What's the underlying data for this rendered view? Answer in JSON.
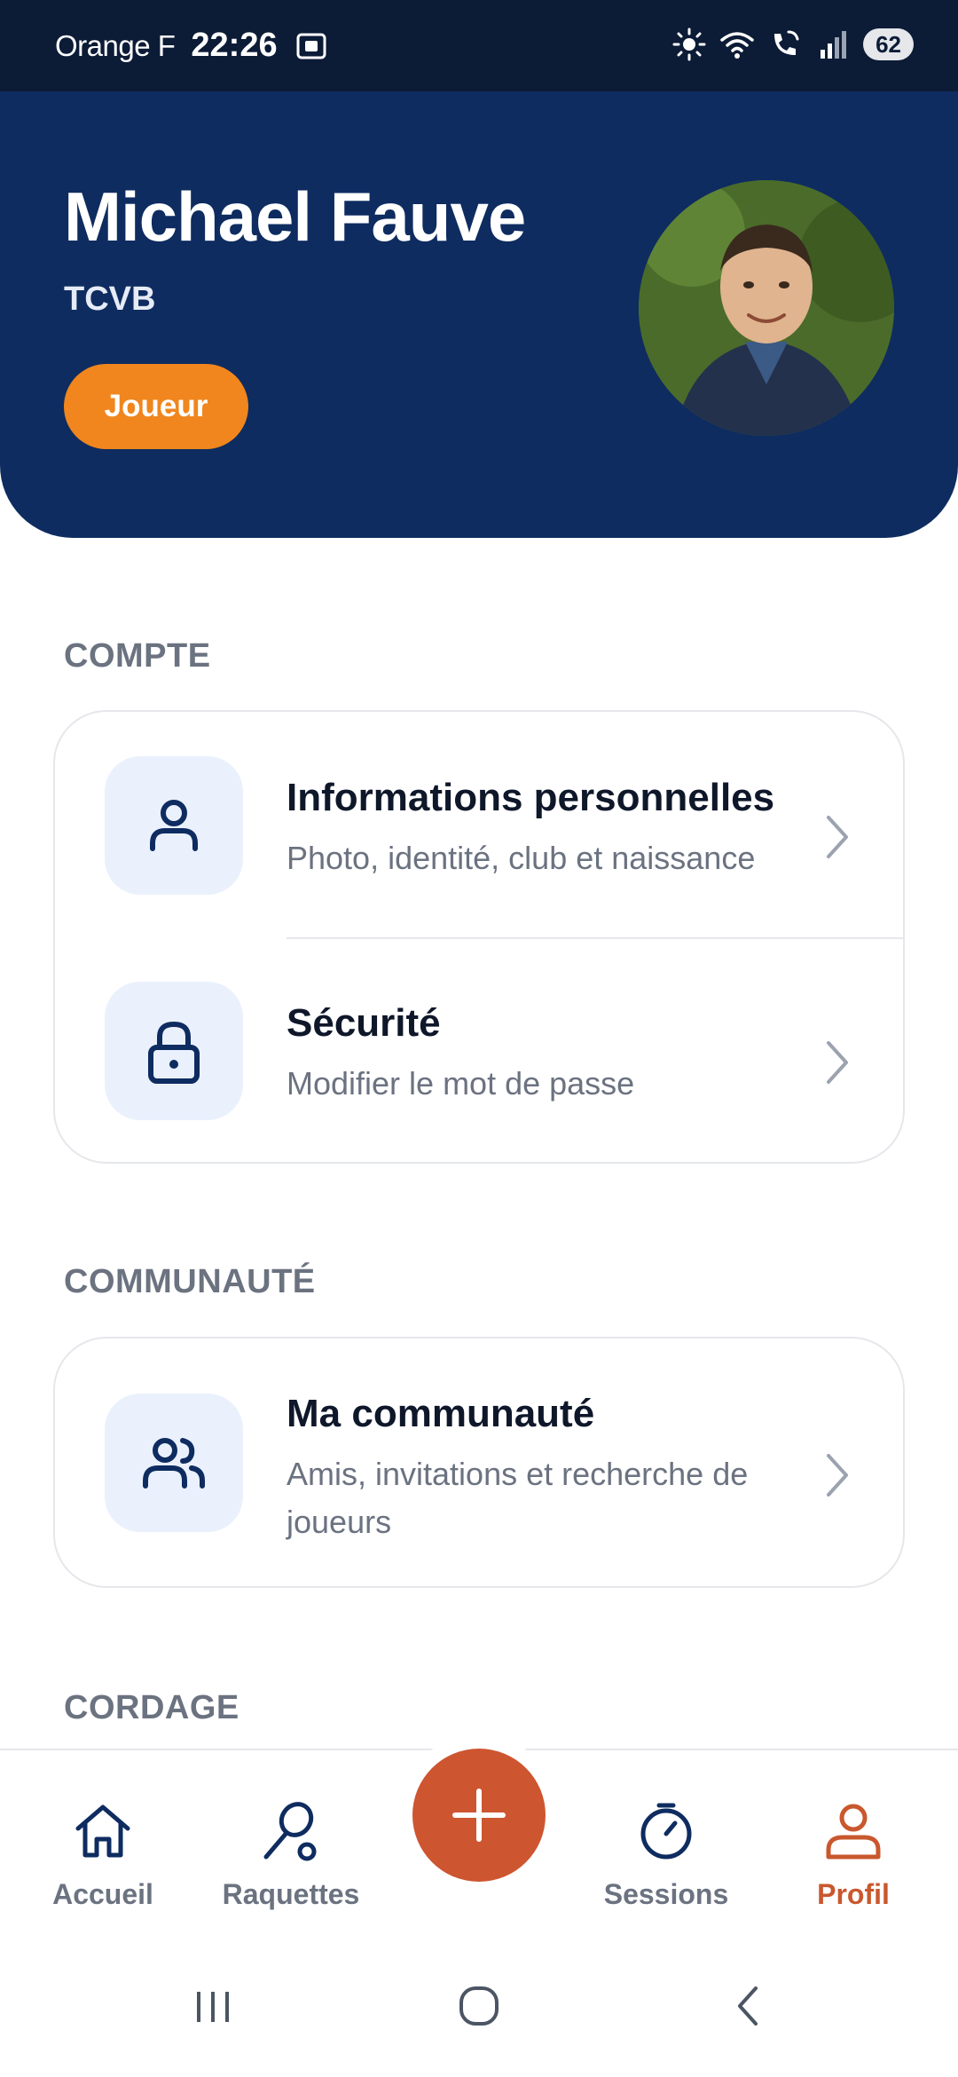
{
  "status_bar": {
    "carrier": "Orange F",
    "time": "22:26",
    "battery": "62"
  },
  "profile": {
    "name": "Michael Fauve",
    "club": "TCVB",
    "role_badge": "Joueur"
  },
  "sections": {
    "compte": {
      "title": "COMPTE",
      "items": [
        {
          "title": "Informations personnelles",
          "subtitle": "Photo, identité, club et naissance",
          "icon": "user-icon"
        },
        {
          "title": "Sécurité",
          "subtitle": "Modifier le mot de passe",
          "icon": "lock-icon"
        }
      ]
    },
    "communaute": {
      "title": "COMMUNAUTÉ",
      "items": [
        {
          "title": "Ma communauté",
          "subtitle": "Amis, invitations et recherche de joueurs",
          "icon": "users-icon"
        }
      ]
    },
    "cordage": {
      "title": "CORDAGE"
    }
  },
  "bottom_nav": {
    "items": [
      {
        "label": "Accueil",
        "icon": "home-icon",
        "active": false
      },
      {
        "label": "Raquettes",
        "icon": "racket-icon",
        "active": false
      },
      {
        "label": "Sessions",
        "icon": "timer-icon",
        "active": false
      },
      {
        "label": "Profil",
        "icon": "user-icon",
        "active": true
      }
    ],
    "fab_icon": "plus-icon"
  },
  "colors": {
    "header_bg": "#0e2c60",
    "badge": "#f0861d",
    "accent": "#cd5530",
    "icon_tile": "#eaf1fd",
    "icon_stroke": "#0e2c60"
  }
}
